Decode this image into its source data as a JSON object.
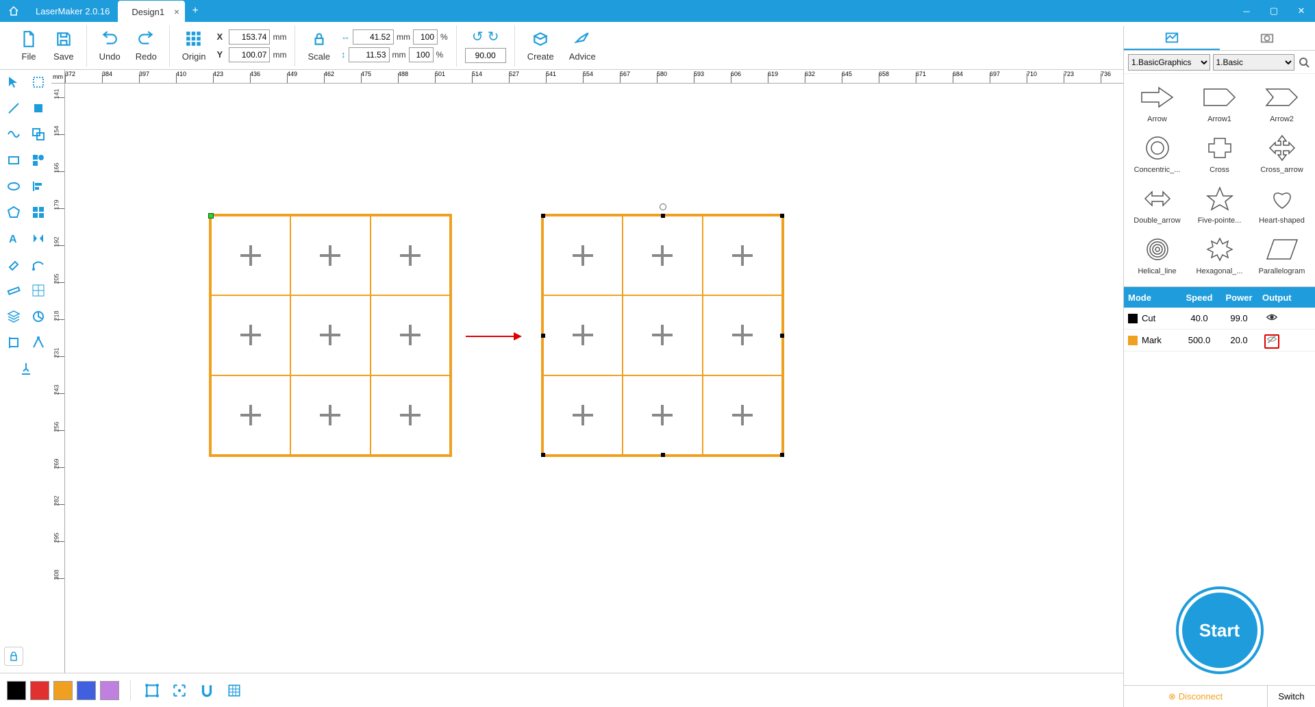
{
  "titlebar": {
    "app_name": "LaserMaker 2.0.16",
    "tab_name": "Design1"
  },
  "toolbar": {
    "file": "File",
    "save": "Save",
    "undo": "Undo",
    "redo": "Redo",
    "origin": "Origin",
    "scale": "Scale",
    "create": "Create",
    "advice": "Advice",
    "x_label": "X",
    "y_label": "Y",
    "x_val": "153.74",
    "y_val": "100.07",
    "unit_mm": "mm",
    "w_val": "41.52",
    "h_val": "11.53",
    "pct_w": "100",
    "pct_h": "100",
    "pct": "%",
    "rot": "90.00"
  },
  "ruler": {
    "unit": "mm",
    "h_ticks": [
      "372",
      "384",
      "397",
      "410",
      "423",
      "436",
      "449",
      "462",
      "475",
      "488",
      "501",
      "514",
      "527",
      "541",
      "554",
      "567",
      "580",
      "593",
      "606",
      "619",
      "632",
      "645",
      "658",
      "671",
      "684",
      "697",
      "710",
      "723",
      "736"
    ],
    "v_ticks": [
      "141",
      "154",
      "166",
      "179",
      "192",
      "205",
      "218",
      "231",
      "243",
      "256",
      "269",
      "282",
      "295",
      "308"
    ]
  },
  "right": {
    "sel1": "1.BasicGraphics",
    "sel2": "1.Basic",
    "shapes": [
      "Arrow",
      "Arrow1",
      "Arrow2",
      "Concentric_...",
      "Cross",
      "Cross_arrow",
      "Double_arrow",
      "Five-pointe...",
      "Heart-shaped",
      "Helical_line",
      "Hexagonal_...",
      "Parallelogram"
    ],
    "params_hdr": {
      "mode": "Mode",
      "speed": "Speed",
      "power": "Power",
      "output": "Output"
    },
    "params": [
      {
        "color": "#000",
        "mode": "Cut",
        "speed": "40.0",
        "power": "99.0",
        "visible": true
      },
      {
        "color": "#f0a020",
        "mode": "Mark",
        "speed": "500.0",
        "power": "20.0",
        "visible": false
      }
    ],
    "start": "Start",
    "disconnect": "Disconnect",
    "switch": "Switch"
  },
  "bottom": {
    "colors": [
      "#000000",
      "#e03030",
      "#f0a020",
      "#4060e0",
      "#c080e0"
    ]
  }
}
